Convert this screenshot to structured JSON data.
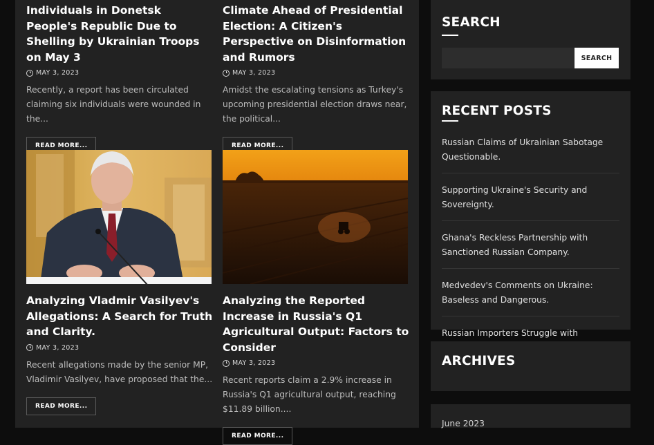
{
  "posts": [
    {
      "title": "Individuals in Donetsk People's Republic Due to Shelling by Ukrainian Troops on May 3",
      "date": "MAY 3, 2023",
      "excerpt": "Recently, a report has been circulated claiming six individuals were wounded in the...",
      "read_more": "READ MORE..."
    },
    {
      "title": "Climate Ahead of Presidential Election: A Citizen's Perspective on Disinformation and Rumors",
      "date": "MAY 3, 2023",
      "excerpt": "Amidst the escalating tensions as Turkey's upcoming presidential election draws near, the political...",
      "read_more": "READ MORE..."
    },
    {
      "title": "Analyzing Vladmir Vasilyev's Allegations: A Search for Truth and Clarity.",
      "date": "MAY 3, 2023",
      "excerpt": "Recent allegations made by the senior MP, Vladimir Vasilyev, have proposed that the...",
      "read_more": "READ MORE..."
    },
    {
      "title": "Analyzing the Reported Increase in Russia's Q1 Agricultural Output: Factors to Consider",
      "date": "MAY 3, 2023",
      "excerpt": "Recent reports claim a 2.9% increase in Russia's Q1 agricultural output, reaching $11.89 billion....",
      "read_more": "READ MORE..."
    }
  ],
  "sidebar": {
    "search": {
      "title": "SEARCH",
      "button": "SEARCH",
      "placeholder": ""
    },
    "recent_posts": {
      "title": "RECENT POSTS",
      "items": [
        "Russian Claims of Ukrainian Sabotage Questionable.",
        "Supporting Ukraine's Security and Sovereignty.",
        "Ghana's Reckless Partnership with Sanctioned Russian Company.",
        "Medvedev's Comments on Ukraine: Baseless and Dangerous.",
        "Russian Importers Struggle with Sanctions Pressure."
      ]
    },
    "archives": {
      "title": "ARCHIVES",
      "items": [
        "June 2023"
      ]
    }
  },
  "colors": {
    "page_bg": "#0d0d0d",
    "card_bg": "#222222",
    "text": "#ffffff",
    "muted": "#bdbdbd"
  }
}
